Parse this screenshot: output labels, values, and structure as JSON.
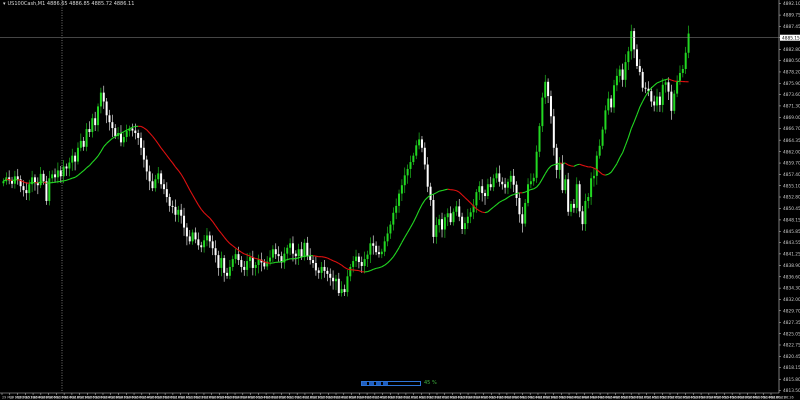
{
  "header": {
    "symbol_line": "US100Cash,M1 4886.65 4886.85 4885.72 4886.11",
    "marker_icon": "triangle-down-icon"
  },
  "status": {
    "progress_pct": 45,
    "progress_label": "45 %"
  },
  "colors": {
    "bull": "#22d822",
    "bear": "#ffffff",
    "ma_up": "#22d822",
    "ma_down": "#e01010",
    "grid_text": "#cccccc",
    "bg": "#000000"
  },
  "chart_data": {
    "type": "candlestick",
    "title": "",
    "ylim": [
      4813.0,
      4892.0
    ],
    "y_ticks": [
      "4892.10",
      "4889.75",
      "4887.45",
      "4885.15",
      "4882.80",
      "4880.50",
      "4878.20",
      "4875.90",
      "4873.60",
      "4871.30",
      "4869.00",
      "4866.70",
      "4864.35",
      "4862.00",
      "4859.70",
      "4857.40",
      "4855.10",
      "4852.80",
      "4850.45",
      "4848.15",
      "4845.85",
      "4843.55",
      "4841.25",
      "4838.90",
      "4836.60",
      "4834.30",
      "4832.00",
      "4829.70",
      "4827.35",
      "4825.05",
      "4822.75",
      "4820.45",
      "4818.15",
      "4815.80",
      "4813.50"
    ],
    "current_price": "4885.15",
    "x_ticks": [
      "29 Mar 2021",
      "29 Mar 23:51",
      "29 Mar 23:54",
      "30 Mar 00:02",
      "30 Mar 00:06",
      "30 Mar 00:10",
      "30 Mar 00:14",
      "30 Mar 00:18",
      "30 Mar 00:22",
      "30 Mar 00:26",
      "30 Mar 00:30",
      "30 Mar 00:34",
      "30 Mar 00:38",
      "30 Mar 00:42",
      "30 Mar 00:46",
      "30 Mar 00:50",
      "30 Mar 00:54",
      "30 Mar 00:58",
      "30 Mar 01:02",
      "30 Mar 01:06",
      "30 Mar 01:10",
      "30 Mar 01:14",
      "30 Mar 01:18",
      "30 Mar 01:22",
      "30 Mar 01:26",
      "30 Mar 01:30",
      "30 Mar 01:34",
      "30 Mar 01:38",
      "30 Mar 01:42",
      "30 Mar 01:46",
      "30 Mar 01:50",
      "30 Mar 01:54",
      "30 Mar 01:58",
      "30 Mar 02:02",
      "30 Mar 02:06",
      "30 Mar 02:10",
      "30 Mar 02:14",
      "30 Mar 02:18",
      "30 Mar 02:22",
      "30 Mar 02:26",
      "30 Mar 02:30",
      "30 Mar 02:34",
      "30 Mar 02:38",
      "30 Mar 02:42",
      "30 Mar 02:46",
      "30 Mar 02:50",
      "30 Mar 02:54",
      "30 Mar 02:58",
      "30 Mar 03:02",
      "30 Mar 03:06",
      "30 Mar 03:10",
      "30 Mar 03:14",
      "30 Mar 03:18",
      "30 Mar 03:22",
      "30 Mar 03:26",
      "30 Mar 03:30",
      "30 Mar 03:34",
      "30 Mar 03:38",
      "30 Mar 03:42",
      "30 Mar 03:46",
      "30 Mar 03:50",
      "30 Mar 03:54",
      "30 Mar 03:58",
      "30 Mar 04:02",
      "30 Mar 04:06",
      "30 Mar 04:10",
      "30 Mar 04:14",
      "30 Mar 04:18",
      "30 Mar 04:22",
      "30 Mar 04:26",
      "30 Mar 04:30",
      "30 Mar 04:34",
      "30 Mar 04:38",
      "30 Mar 04:42",
      "30 Mar 04:46",
      "30 Mar 04:50",
      "30 Mar 04:54",
      "30 Mar 04:58",
      "30 Mar 05:02",
      "30 Mar 05:06",
      "30 Mar 05:10",
      "30 Mar 05:14",
      "30 Mar 05:18",
      "30 Mar 05:22",
      "30 Mar 05:26",
      "30 Mar 05:30",
      "30 Mar 05:34",
      "30 Mar 05:38",
      "30 Mar 05:42",
      "30 Mar 05:46",
      "30 Mar 05:50",
      "30 Mar 05:54",
      "30 Mar 05:58",
      "30 Mar 06:02",
      "30 Mar 06:06",
      "30 Mar 06:10",
      "30 Mar 06:14",
      "30 Mar 06:18",
      "30 Mar 06:22",
      "30 Mar 06:26"
    ],
    "close_series": [
      4856.0,
      4856.8,
      4856.2,
      4855.5,
      4857.0,
      4856.4,
      4855.0,
      4854.2,
      4853.6,
      4855.4,
      4856.8,
      4855.8,
      4855.2,
      4857.5,
      4856.0,
      4852.0,
      4856.6,
      4857.4,
      4856.8,
      4858.2,
      4857.0,
      4859.0,
      4858.6,
      4859.8,
      4861.2,
      4860.0,
      4862.8,
      4864.2,
      4863.0,
      4866.6,
      4866.0,
      4868.8,
      4867.4,
      4871.2,
      4874.0,
      4872.2,
      4869.4,
      4868.0,
      4866.8,
      4865.2,
      4865.8,
      4863.9,
      4865.0,
      4866.2,
      4866.7,
      4866.3,
      4865.8,
      4864.8,
      4862.8,
      4860.4,
      4858.0,
      4856.0,
      4854.6,
      4856.4,
      4857.6,
      4855.4,
      4854.4,
      4852.8,
      4851.0,
      4850.8,
      4849.2,
      4850.2,
      4849.0,
      4846.6,
      4844.8,
      4843.8,
      4845.6,
      4844.2,
      4843.0,
      4842.6,
      4844.0,
      4845.0,
      4843.8,
      4842.4,
      4841.0,
      4838.4,
      4840.4,
      4837.4,
      4836.8,
      4838.6,
      4840.2,
      4841.2,
      4840.0,
      4838.6,
      4838.0,
      4839.8,
      4840.6,
      4838.4,
      4839.0,
      4840.1,
      4839.5,
      4838.7,
      4839.7,
      4840.5,
      4842.2,
      4841.2,
      4840.8,
      4839.5,
      4841.3,
      4842.5,
      4843.4,
      4841.3,
      4840.8,
      4842.2,
      4840.6,
      4843.5,
      4840.8,
      4840.0,
      4839.4,
      4837.9,
      4837.4,
      4838.6,
      4837.8,
      4837.2,
      4836.4,
      4835.7,
      4836.2,
      4833.3,
      4834.1,
      4833.5,
      4836.7,
      4838.6,
      4839.8,
      4840.7,
      4839.6,
      4838.8,
      4840.2,
      4841.1,
      4843.4,
      4842.9,
      4841.6,
      4841.2,
      4841.7,
      4843.8,
      4845.4,
      4847.2,
      4849.6,
      4851.0,
      4853.5,
      4855.2,
      4857.2,
      4858.5,
      4859.9,
      4861.2,
      4863.3,
      4864.5,
      4862.8,
      4859.4,
      4854.9,
      4852.2,
      4844.7,
      4847.1,
      4848.3,
      4846.2,
      4848.7,
      4849.5,
      4847.7,
      4849.8,
      4850.9,
      4848.8,
      4846.3,
      4847.5,
      4848.8,
      4849.7,
      4851.1,
      4853.8,
      4855.0,
      4853.6,
      4853.0,
      4855.4,
      4854.8,
      4856.6,
      4857.6,
      4855.9,
      4855.4,
      4854.7,
      4855.9,
      4857.1,
      4855.3,
      4852.6,
      4849.3,
      4847.4,
      4851.6,
      4855.4,
      4856.0,
      4856.7,
      4862.0,
      4867.2,
      4873.0,
      4876.2,
      4873.3,
      4869.2,
      4862.8,
      4858.3,
      4859.7,
      4854.2,
      4856.4,
      4849.8,
      4851.4,
      4850.6,
      4855.4,
      4849.9,
      4847.3,
      4852.0,
      4852.8,
      4856.6,
      4857.1,
      4861.2,
      4863.2,
      4866.5,
      4870.4,
      4872.8,
      4871.0,
      4875.5,
      4877.4,
      4878.7,
      4876.6,
      4880.2,
      4882.4,
      4886.5,
      4882.8,
      4879.4,
      4878.2,
      4875.0,
      4874.8,
      4874.3,
      4872.2,
      4871.4,
      4873.2,
      4871.5,
      4875.6,
      4876.1,
      4874.2,
      4870.3,
      4873.8,
      4876.4,
      4878.0,
      4878.8,
      4882.1,
      4886.0
    ],
    "ma_period_note": ""
  }
}
